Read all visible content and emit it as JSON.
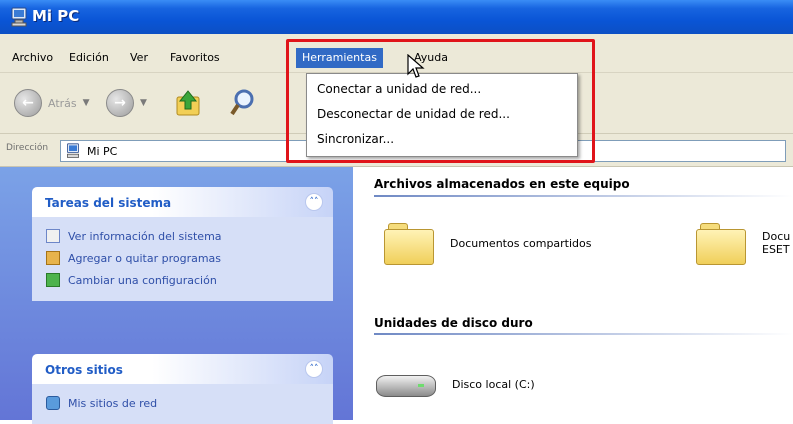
{
  "window": {
    "title": "Mi PC"
  },
  "menubar": {
    "items": [
      "Archivo",
      "Edición",
      "Ver",
      "Favoritos",
      "Herramientas",
      "Ayuda"
    ],
    "active_index": 4
  },
  "toolbar": {
    "back_label": "Atrás"
  },
  "address": {
    "label": "Dirección",
    "value": "Mi PC"
  },
  "tools_menu": {
    "items": [
      "Conectar a unidad de red...",
      "Desconectar de unidad de red...",
      "Sincronizar..."
    ]
  },
  "sidebar": {
    "system_tasks": {
      "title": "Tareas del sistema",
      "items": [
        "Ver información del sistema",
        "Agregar o quitar programas",
        "Cambiar una configuración"
      ]
    },
    "other_places": {
      "title": "Otros sitios",
      "items": [
        "Mis sitios de red"
      ]
    }
  },
  "main": {
    "stored_files": {
      "heading": "Archivos almacenados en este equipo",
      "items": [
        "Documentos compartidos",
        "Docu",
        "ESET"
      ]
    },
    "hard_drives": {
      "heading": "Unidades de disco duro",
      "items": [
        "Disco local (C:)"
      ]
    }
  },
  "colors": {
    "highlight": "#e0141a",
    "titlebar": "#0a55d6",
    "menu_active": "#316ac5"
  }
}
